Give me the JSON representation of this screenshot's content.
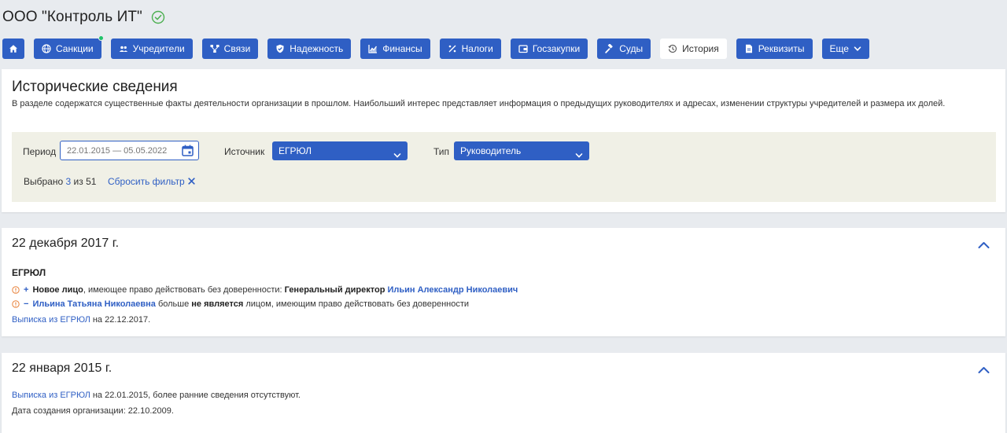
{
  "company": {
    "title": "ООО \"Контроль ИТ\"",
    "verified_icon": "check-circle-icon"
  },
  "colors": {
    "accent": "#2f5fc4",
    "background": "#e8ebef",
    "filter_bg": "#f0f0e6",
    "badge_green": "#21c36a",
    "verified_green": "#4caf50",
    "warn_orange": "#e8823b"
  },
  "nav": {
    "home_icon": "home-icon",
    "sanctions": "Санкции",
    "founders": "Учредители",
    "links": "Связи",
    "reliability": "Надежность",
    "finance": "Финансы",
    "taxes": "Налоги",
    "procurement": "Госзакупки",
    "courts": "Суды",
    "history": "История",
    "requisites": "Реквизиты",
    "more": "Еще"
  },
  "info": {
    "title": "Исторические сведения",
    "description": "В разделе содержатся существенные факты деятельности организации в прошлом. Наибольший интерес представляет информация о предыдущих руководителях и адресах, изменении структуры учредителей и размера их долей."
  },
  "filters": {
    "period_label": "Период",
    "period_placeholder": "22.01.2015 — 05.05.2022",
    "source_label": "Источник",
    "source_value": "ЕГРЮЛ",
    "type_label": "Тип",
    "type_value": "Руководитель",
    "selected_prefix": "Выбрано",
    "selected_count": "3",
    "selected_suffix": "из 51",
    "reset_label": "Сбросить фильтр"
  },
  "events": [
    {
      "date": "22 декабря 2017 г.",
      "source": "ЕГРЮЛ",
      "line1": {
        "sign": "+",
        "bold_start": "Новое лицо",
        "text_mid": ", имеющее право действовать без доверенности: ",
        "role": "Генеральный директор",
        "person": "Ильин Александр Николаевич"
      },
      "line2": {
        "sign": "−",
        "person": "Ильина Татьяна Николаевна",
        "text_mid": " больше ",
        "bold_mid": "не является",
        "text_end": " лицом, имеющим право действовать без доверенности"
      },
      "extract_link": "Выписка из ЕГРЮЛ",
      "extract_suffix": " на 22.12.2017."
    },
    {
      "date": "22 января 2015 г.",
      "extract_link": "Выписка из ЕГРЮЛ",
      "extract_suffix": " на 22.01.2015, более ранние сведения отсутствуют.",
      "creation_note": "Дата создания организации: 22.10.2009."
    }
  ]
}
